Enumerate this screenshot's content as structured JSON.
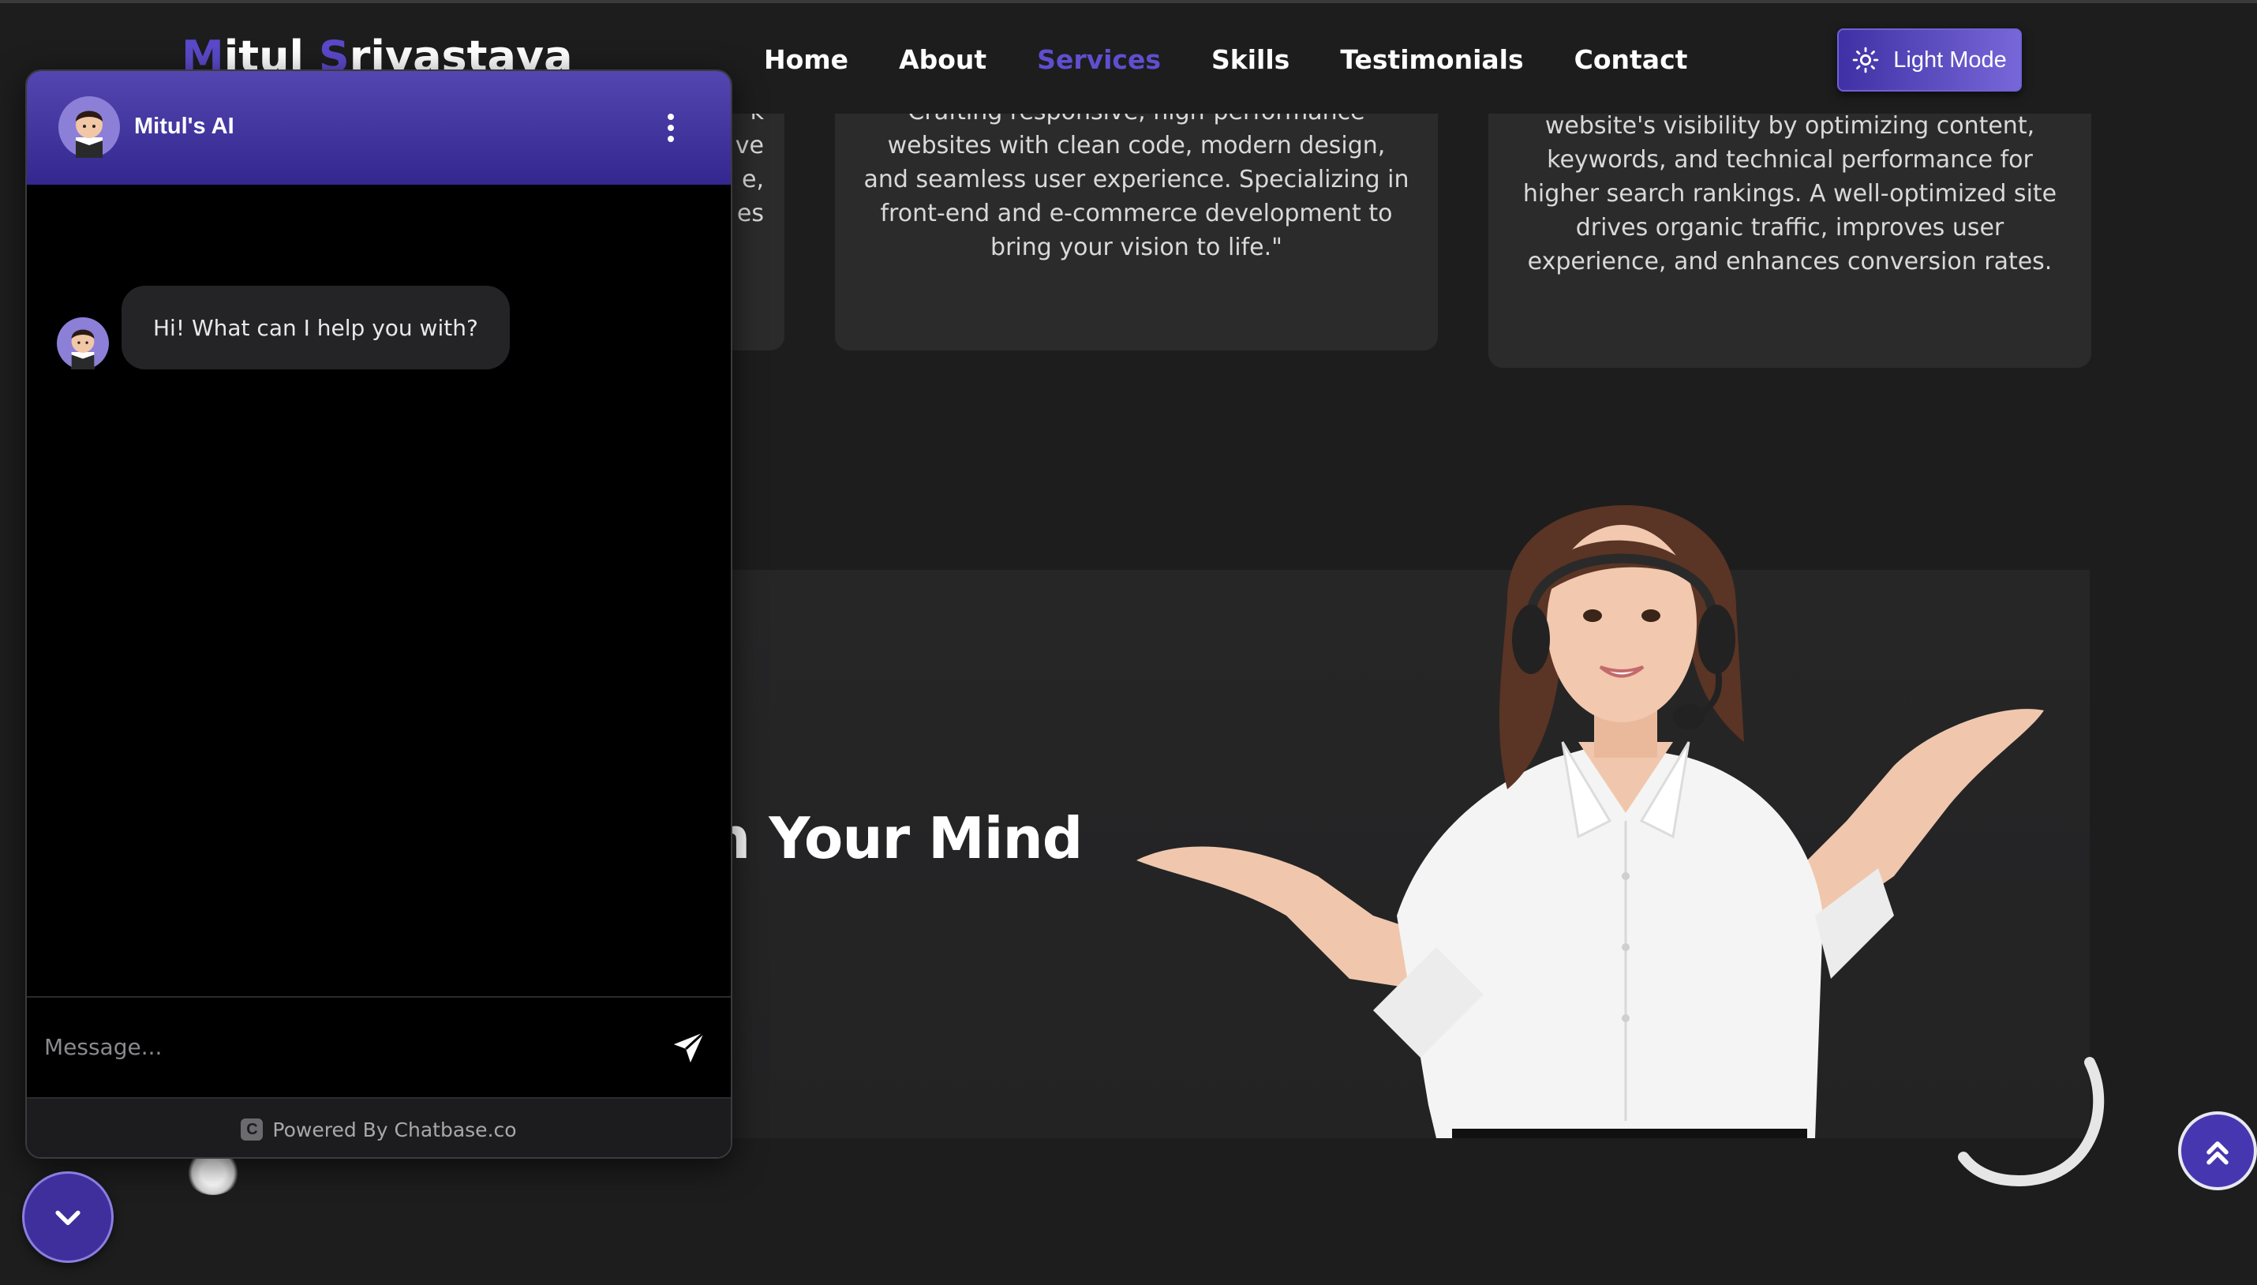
{
  "header": {
    "logo_part1": "M",
    "logo_part2": "itul ",
    "logo_part3": "S",
    "logo_part4": "rivastava",
    "nav": [
      {
        "label": "Home"
      },
      {
        "label": "About"
      },
      {
        "label": "Services",
        "active": true
      },
      {
        "label": "Skills"
      },
      {
        "label": "Testimonials"
      },
      {
        "label": "Contact"
      }
    ],
    "mode_button": "Light Mode",
    "mode_icon": "sun-icon"
  },
  "services": {
    "card1_fragments": [
      "k",
      "ve",
      "e,",
      "es"
    ],
    "card2_text": "Crafting responsive, high-performance websites with clean code, modern design, and seamless user experience. Specializing in front-end and e-commerce development to bring your vision to life.\"",
    "card3_text": "website's visibility by optimizing content, keywords, and technical performance for higher search rankings. A well-optimized site drives organic traffic, improves user experience, and enhances conversion rates."
  },
  "banner": {
    "title": "n Your Mind"
  },
  "chat": {
    "bot_name": "Mitul's AI",
    "greeting": "Hi! What can I help you with?",
    "input_placeholder": "Message...",
    "powered_by": "Powered By Chatbase.co",
    "footer_logo_letter": "C"
  },
  "colors": {
    "accent": "#5f4fd0",
    "background": "#1d1d1e",
    "card": "#2b2b2c",
    "chat_header": "#4a3da8"
  }
}
